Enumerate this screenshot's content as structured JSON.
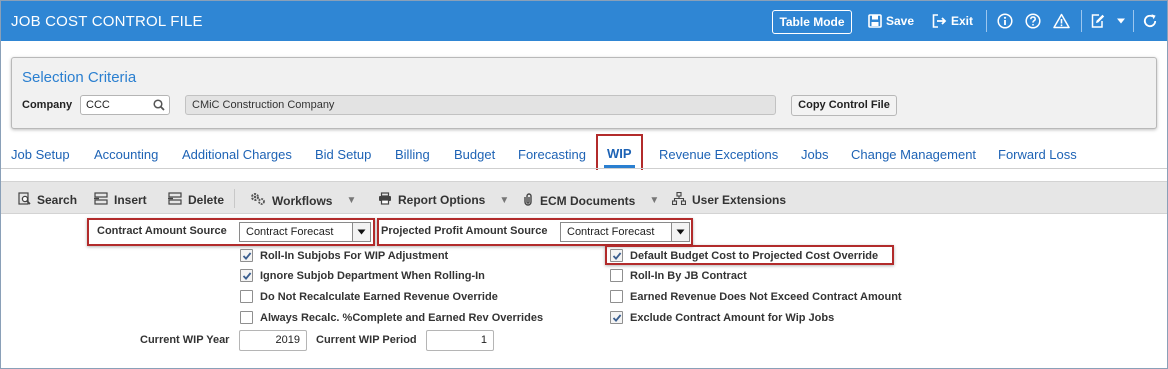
{
  "header": {
    "title": "JOB COST CONTROL FILE",
    "table_mode_label": "Table Mode",
    "save_label": "Save",
    "exit_label": "Exit",
    "accent_color": "#2f86d4"
  },
  "selection": {
    "title": "Selection Criteria",
    "company_label": "Company",
    "company_value": "CCC",
    "company_name": "CMiC Construction Company",
    "copy_button_label": "Copy Control File"
  },
  "tabs": [
    {
      "label": "Job Setup"
    },
    {
      "label": "Accounting"
    },
    {
      "label": "Additional Charges"
    },
    {
      "label": "Bid Setup"
    },
    {
      "label": "Billing"
    },
    {
      "label": "Budget"
    },
    {
      "label": "Forecasting"
    },
    {
      "label": "WIP",
      "active": true
    },
    {
      "label": "Revenue Exceptions"
    },
    {
      "label": "Jobs"
    },
    {
      "label": "Change Management"
    },
    {
      "label": "Forward Loss"
    }
  ],
  "toolbar": {
    "search_label": "Search",
    "insert_label": "Insert",
    "delete_label": "Delete",
    "workflows_label": "Workflows",
    "report_options_label": "Report Options",
    "ecm_documents_label": "ECM Documents",
    "user_extensions_label": "User Extensions"
  },
  "form": {
    "contract_amount_source_label": "Contract Amount Source",
    "contract_amount_source_value": "Contract Forecast",
    "projected_profit_source_label": "Projected Profit Amount Source",
    "projected_profit_source_value": "Contract Forecast",
    "left_checks": [
      {
        "label": "Roll-In Subjobs For WIP Adjustment",
        "checked": true
      },
      {
        "label": "Ignore Subjob Department When Rolling-In",
        "checked": true
      },
      {
        "label": "Do Not Recalculate Earned Revenue Override",
        "checked": false
      },
      {
        "label": "Always Recalc. %Complete and Earned Rev Overrides",
        "checked": false
      }
    ],
    "right_checks": [
      {
        "label": "Default Budget Cost to Projected Cost Override",
        "checked": true
      },
      {
        "label": "Roll-In By JB Contract",
        "checked": false
      },
      {
        "label": "Earned Revenue Does Not Exceed Contract Amount",
        "checked": false
      },
      {
        "label": "Exclude Contract Amount for Wip Jobs",
        "checked": true
      }
    ],
    "current_wip_year_label": "Current WIP Year",
    "current_wip_year_value": "2019",
    "current_wip_period_label": "Current WIP Period",
    "current_wip_period_value": "1"
  }
}
